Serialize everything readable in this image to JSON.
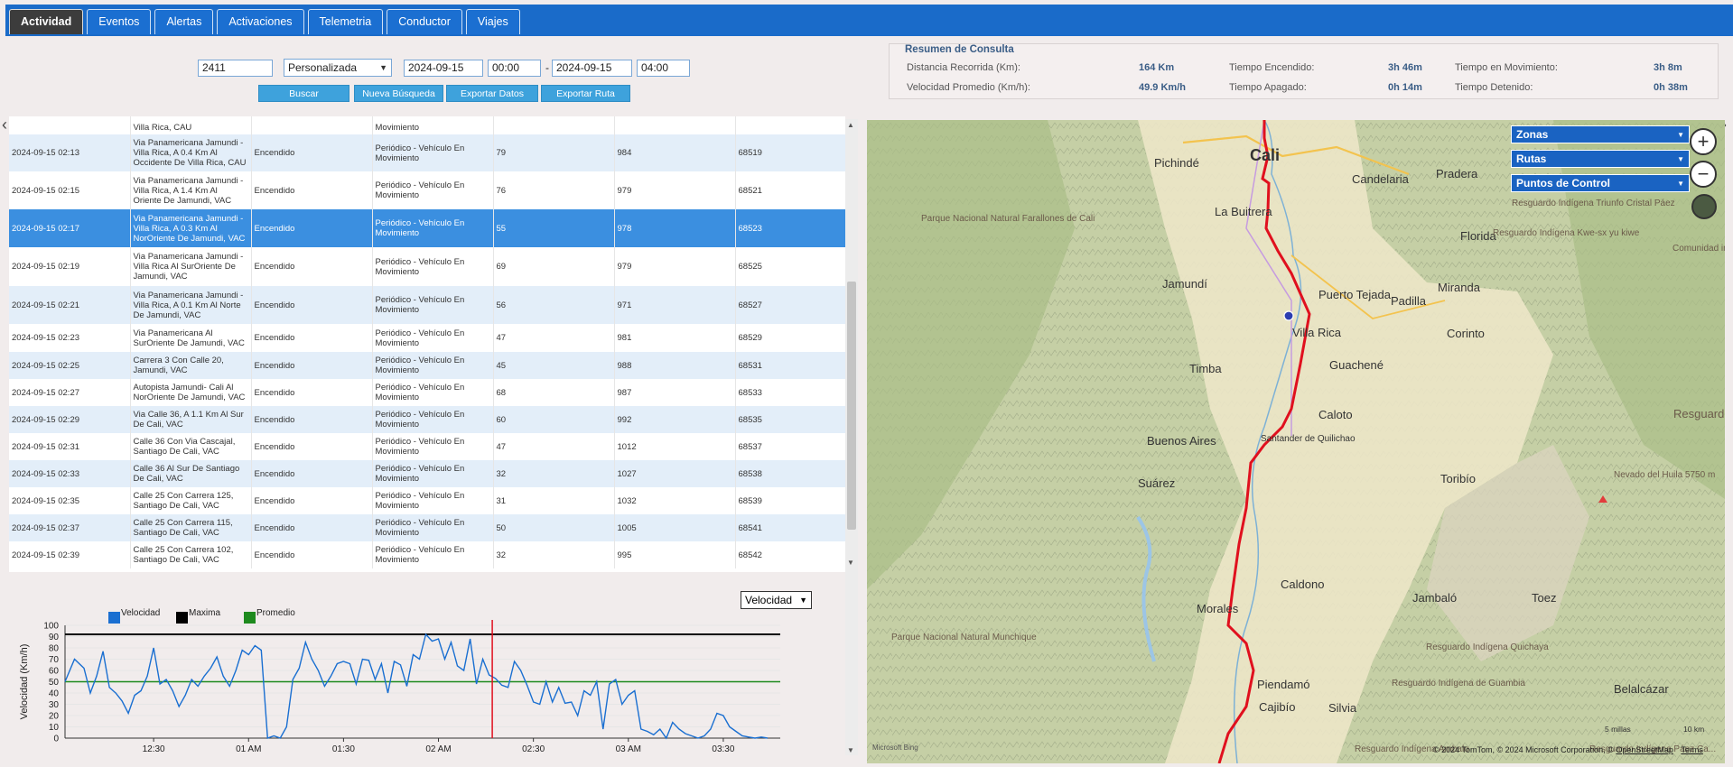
{
  "tabs": [
    {
      "label": "Actividad",
      "active": true
    },
    {
      "label": "Eventos"
    },
    {
      "label": "Alertas"
    },
    {
      "label": "Activaciones"
    },
    {
      "label": "Telemetria"
    },
    {
      "label": "Conductor"
    },
    {
      "label": "Viajes"
    }
  ],
  "query": {
    "vehicle_id": "2411",
    "range_type": "Personalizada",
    "start_date": "2024-09-15",
    "start_time": "00:00",
    "end_date": "2024-09-15",
    "end_time": "04:00",
    "separator": "-"
  },
  "buttons": {
    "search": "Buscar",
    "new_search": "Nueva Búsqueda",
    "export_data": "Exportar Datos",
    "export_route": "Exportar Ruta"
  },
  "summary": {
    "title": "Resumen de Consulta",
    "distance_label": "Distancia Recorrida (Km):",
    "distance_value": "164 Km",
    "avg_speed_label": "Velocidad Promedio (Km/h):",
    "avg_speed_value": "49.9 Km/h",
    "on_time_label": "Tiempo Encendido:",
    "on_time_value": "3h 46m",
    "off_time_label": "Tiempo Apagado:",
    "off_time_value": "0h 14m",
    "moving_time_label": "Tiempo en Movimiento:",
    "moving_time_value": "3h 8m",
    "stopped_time_label": "Tiempo Detenido:",
    "stopped_time_value": "0h 38m"
  },
  "table": {
    "partial_row": {
      "location": "Villa Rica, CAU",
      "event": "Movimiento"
    },
    "rows": [
      {
        "time": "2024-09-15 02:13",
        "location": "Via Panamericana Jamundi - Villa Rica, A 0.4 Km Al Occidente De Villa Rica, CAU",
        "status": "Encendido",
        "event": "Periódico - Vehículo En Movimiento",
        "speed": "79",
        "c6": "984",
        "c7": "68519"
      },
      {
        "time": "2024-09-15 02:15",
        "location": "Via Panamericana Jamundi - Villa Rica, A 1.4 Km Al Oriente De Jamundi, VAC",
        "status": "Encendido",
        "event": "Periódico - Vehículo En Movimiento",
        "speed": "76",
        "c6": "979",
        "c7": "68521"
      },
      {
        "time": "2024-09-15 02:17",
        "location": "Via Panamericana Jamundi - Villa Rica, A 0.3 Km Al NorOriente De Jamundi, VAC",
        "status": "Encendido",
        "event": "Periódico - Vehículo En Movimiento",
        "speed": "55",
        "c6": "978",
        "c7": "68523",
        "selected": true
      },
      {
        "time": "2024-09-15 02:19",
        "location": "Via Panamericana Jamundi - Villa Rica Al SurOriente De Jamundi, VAC",
        "status": "Encendido",
        "event": "Periódico - Vehículo En Movimiento",
        "speed": "69",
        "c6": "979",
        "c7": "68525"
      },
      {
        "time": "2024-09-15 02:21",
        "location": "Via Panamericana Jamundi - Villa Rica, A 0.1 Km Al Norte De Jamundi, VAC",
        "status": "Encendido",
        "event": "Periódico - Vehículo En Movimiento",
        "speed": "56",
        "c6": "971",
        "c7": "68527"
      },
      {
        "time": "2024-09-15 02:23",
        "location": "Via Panamericana Al SurOriente De Jamundi, VAC",
        "status": "Encendido",
        "event": "Periódico - Vehículo En Movimiento",
        "speed": "47",
        "c6": "981",
        "c7": "68529"
      },
      {
        "time": "2024-09-15 02:25",
        "location": "Carrera 3 Con Calle 20, Jamundi, VAC",
        "status": "Encendido",
        "event": "Periódico - Vehículo En Movimiento",
        "speed": "45",
        "c6": "988",
        "c7": "68531"
      },
      {
        "time": "2024-09-15 02:27",
        "location": "Autopista Jamundi- Cali Al NorOriente De Jamundi, VAC",
        "status": "Encendido",
        "event": "Periódico - Vehículo En Movimiento",
        "speed": "68",
        "c6": "987",
        "c7": "68533"
      },
      {
        "time": "2024-09-15 02:29",
        "location": "Via Calle 36, A 1.1 Km Al Sur De Cali, VAC",
        "status": "Encendido",
        "event": "Periódico - Vehículo En Movimiento",
        "speed": "60",
        "c6": "992",
        "c7": "68535"
      },
      {
        "time": "2024-09-15 02:31",
        "location": "Calle 36 Con Via Cascajal, Santiago De Cali, VAC",
        "status": "Encendido",
        "event": "Periódico - Vehículo En Movimiento",
        "speed": "47",
        "c6": "1012",
        "c7": "68537"
      },
      {
        "time": "2024-09-15 02:33",
        "location": "Calle 36 Al Sur De Santiago De Cali, VAC",
        "status": "Encendido",
        "event": "Periódico - Vehículo En Movimiento",
        "speed": "32",
        "c6": "1027",
        "c7": "68538"
      },
      {
        "time": "2024-09-15 02:35",
        "location": "Calle 25 Con Carrera 125, Santiago De Cali, VAC",
        "status": "Encendido",
        "event": "Periódico - Vehículo En Movimiento",
        "speed": "31",
        "c6": "1032",
        "c7": "68539"
      },
      {
        "time": "2024-09-15 02:37",
        "location": "Calle 25 Con Carrera 115, Santiago De Cali, VAC",
        "status": "Encendido",
        "event": "Periódico - Vehículo En Movimiento",
        "speed": "50",
        "c6": "1005",
        "c7": "68541"
      },
      {
        "time": "2024-09-15 02:39",
        "location": "Calle 25 Con Carrera 102, Santiago De Cali, VAC",
        "status": "Encendido",
        "event": "Periódico - Vehículo En Movimiento",
        "speed": "32",
        "c6": "995",
        "c7": "68542"
      }
    ]
  },
  "chart_selector": "Velocidad",
  "chart_data": {
    "type": "line",
    "ylabel": "Velocidad (Km/h)",
    "ylim": [
      0,
      100
    ],
    "yticks": [
      0,
      10,
      20,
      30,
      40,
      50,
      60,
      70,
      80,
      90,
      100
    ],
    "xticks": [
      {
        "label": "12:30",
        "t": 30
      },
      {
        "label": "01 AM",
        "t": 60
      },
      {
        "label": "01:30",
        "t": 90
      },
      {
        "label": "02 AM",
        "t": 120
      },
      {
        "label": "02:30",
        "t": 150
      },
      {
        "label": "03 AM",
        "t": 180
      },
      {
        "label": "03:30",
        "t": 210
      }
    ],
    "xlim": [
      2,
      228
    ],
    "legend": [
      "Velocidad",
      "Maxima",
      "Promedio"
    ],
    "maxima": 92,
    "promedio": 50,
    "cursor_t": 137,
    "series_speed": [
      [
        2,
        50
      ],
      [
        5,
        70
      ],
      [
        8,
        62
      ],
      [
        10,
        40
      ],
      [
        12,
        55
      ],
      [
        14,
        77
      ],
      [
        16,
        45
      ],
      [
        18,
        40
      ],
      [
        20,
        33
      ],
      [
        22,
        22
      ],
      [
        24,
        38
      ],
      [
        26,
        42
      ],
      [
        28,
        55
      ],
      [
        30,
        80
      ],
      [
        32,
        48
      ],
      [
        34,
        52
      ],
      [
        36,
        42
      ],
      [
        38,
        28
      ],
      [
        40,
        38
      ],
      [
        42,
        52
      ],
      [
        44,
        46
      ],
      [
        46,
        55
      ],
      [
        48,
        62
      ],
      [
        50,
        72
      ],
      [
        52,
        55
      ],
      [
        54,
        46
      ],
      [
        56,
        60
      ],
      [
        58,
        78
      ],
      [
        60,
        74
      ],
      [
        62,
        82
      ],
      [
        64,
        78
      ],
      [
        66,
        0
      ],
      [
        68,
        2
      ],
      [
        70,
        0
      ],
      [
        72,
        10
      ],
      [
        74,
        52
      ],
      [
        76,
        62
      ],
      [
        78,
        85
      ],
      [
        80,
        70
      ],
      [
        82,
        60
      ],
      [
        84,
        46
      ],
      [
        86,
        55
      ],
      [
        88,
        66
      ],
      [
        90,
        68
      ],
      [
        92,
        66
      ],
      [
        94,
        48
      ],
      [
        96,
        70
      ],
      [
        98,
        69
      ],
      [
        100,
        52
      ],
      [
        102,
        66
      ],
      [
        104,
        40
      ],
      [
        106,
        68
      ],
      [
        108,
        65
      ],
      [
        110,
        46
      ],
      [
        112,
        74
      ],
      [
        114,
        70
      ],
      [
        116,
        92
      ],
      [
        118,
        86
      ],
      [
        120,
        88
      ],
      [
        122,
        70
      ],
      [
        124,
        85
      ],
      [
        126,
        64
      ],
      [
        128,
        60
      ],
      [
        130,
        88
      ],
      [
        132,
        48
      ],
      [
        134,
        70
      ],
      [
        136,
        56
      ],
      [
        138,
        53
      ],
      [
        140,
        47
      ],
      [
        142,
        45
      ],
      [
        144,
        68
      ],
      [
        146,
        60
      ],
      [
        148,
        47
      ],
      [
        150,
        32
      ],
      [
        152,
        30
      ],
      [
        154,
        50
      ],
      [
        156,
        32
      ],
      [
        158,
        45
      ],
      [
        160,
        31
      ],
      [
        162,
        32
      ],
      [
        164,
        20
      ],
      [
        166,
        42
      ],
      [
        168,
        38
      ],
      [
        170,
        50
      ],
      [
        172,
        8
      ],
      [
        174,
        48
      ],
      [
        176,
        52
      ],
      [
        178,
        30
      ],
      [
        180,
        38
      ],
      [
        182,
        42
      ],
      [
        184,
        8
      ],
      [
        186,
        6
      ],
      [
        188,
        3
      ],
      [
        190,
        8
      ],
      [
        192,
        0
      ],
      [
        194,
        14
      ],
      [
        196,
        8
      ],
      [
        198,
        4
      ],
      [
        200,
        2
      ],
      [
        202,
        0
      ],
      [
        204,
        2
      ],
      [
        206,
        8
      ],
      [
        208,
        22
      ],
      [
        210,
        20
      ],
      [
        212,
        10
      ],
      [
        214,
        6
      ],
      [
        216,
        2
      ],
      [
        218,
        1
      ],
      [
        220,
        0
      ],
      [
        222,
        1
      ],
      [
        224,
        0
      ]
    ]
  },
  "map": {
    "controls": [
      "Zonas",
      "Rutas",
      "Puntos de Control"
    ],
    "zoom_in": "+",
    "zoom_out": "−",
    "places": [
      {
        "name": "Cali",
        "big": true
      },
      {
        "name": "Pichindé"
      },
      {
        "name": "Candelaria"
      },
      {
        "name": "Pradera"
      },
      {
        "name": "La Buitrera"
      },
      {
        "name": "Parque Nacional Natural Farallones de Cali"
      },
      {
        "name": "Florida"
      },
      {
        "name": "Resguardo Indígena Triunfo Cristal Páez"
      },
      {
        "name": "Resguardo Indígena Kwe-sx yu kiwe"
      },
      {
        "name": "Comunidad indígena de Las Mercedes"
      },
      {
        "name": "Jamundí"
      },
      {
        "name": "Puerto Tejada"
      },
      {
        "name": "Padilla"
      },
      {
        "name": "Miranda"
      },
      {
        "name": "Villa Rica"
      },
      {
        "name": "Corinto"
      },
      {
        "name": "Guachené"
      },
      {
        "name": "Timba"
      },
      {
        "name": "Caloto"
      },
      {
        "name": "Buenos Aires"
      },
      {
        "name": "Santander de Quilichao"
      },
      {
        "name": "Suárez"
      },
      {
        "name": "Toribío"
      },
      {
        "name": "Nevado del Huila 5750 m"
      },
      {
        "name": "Caldono"
      },
      {
        "name": "Morales"
      },
      {
        "name": "Jambaló"
      },
      {
        "name": "Toez"
      },
      {
        "name": "Parque Nacional Natural Munchique"
      },
      {
        "name": "Resguardo Indígena Quichaya"
      },
      {
        "name": "Piendamó"
      },
      {
        "name": "Resguardo Indígena de Guambia"
      },
      {
        "name": "Cajibío"
      },
      {
        "name": "Silvia"
      },
      {
        "name": "Belalcázar"
      },
      {
        "name": "Resguardo Indígena Ambalo"
      },
      {
        "name": "Resguardo Indígena Páez Ca..."
      },
      {
        "name": "Resguardo"
      }
    ],
    "scale_miles": "5 millas",
    "scale_km": "10 km",
    "brand": "Microsoft Bing",
    "copyright": "© 2024 TomTom, © 2024 Microsoft Corporation, ©",
    "osm": "OpenStreetMap",
    "terms": "Terms",
    "route_color": "#e0101e"
  }
}
